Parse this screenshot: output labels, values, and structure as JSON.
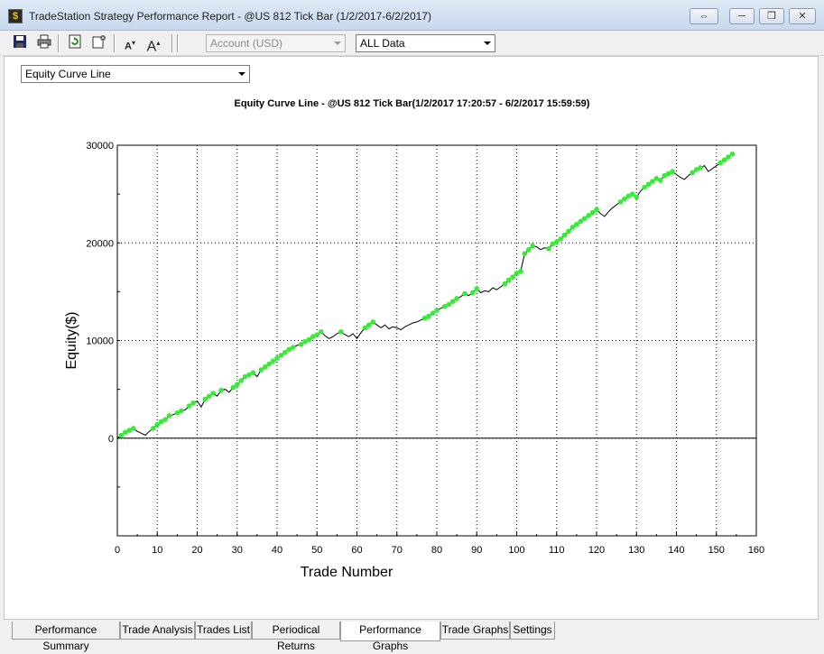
{
  "window": {
    "title": "TradeStation Strategy Performance Report - @US 812 Tick Bar (1/2/2017-6/2/2017)",
    "icon": "tradestation-app-icon",
    "buttons": {
      "restore_icon": "⇔",
      "minimize_icon": "─",
      "maximize_icon": "❐",
      "close_icon": "✕"
    }
  },
  "toolbar": {
    "save_icon": "save-icon",
    "print_icon": "print-icon",
    "refresh_icon": "refresh-icon",
    "settings_icon": "settings-icon",
    "font_smaller_label": "A",
    "font_larger_label": "A",
    "account_combo": "Account (USD)",
    "data_combo": "ALL Data"
  },
  "graph_selector": {
    "value": "Equity Curve Line"
  },
  "chart_title": "Equity Curve Line - @US 812 Tick Bar(1/2/2017 17:20:57 - 6/2/2017 15:59:59)",
  "tabs": [
    {
      "label": "Performance Summary",
      "active": false
    },
    {
      "label": "Trade Analysis",
      "active": false
    },
    {
      "label": "Trades List",
      "active": false
    },
    {
      "label": "Periodical Returns",
      "active": false
    },
    {
      "label": "Performance Graphs",
      "active": true
    },
    {
      "label": "Trade Graphs",
      "active": false
    },
    {
      "label": "Settings",
      "active": false
    }
  ],
  "chart_data": {
    "type": "line",
    "xlabel": "Trade Number",
    "ylabel": "Equity($)",
    "xlim": [
      0,
      160
    ],
    "ylim": [
      -10000,
      30000
    ],
    "x_ticks": [
      0,
      10,
      20,
      30,
      40,
      50,
      60,
      70,
      80,
      90,
      100,
      110,
      120,
      130,
      140,
      150,
      160
    ],
    "y_ticks": [
      0,
      10000,
      20000,
      30000
    ],
    "grid": true,
    "line_color": "#000000",
    "marker_color": "#33ee33",
    "x": [
      0,
      1,
      2,
      3,
      4,
      5,
      6,
      7,
      8,
      9,
      10,
      11,
      12,
      13,
      14,
      15,
      16,
      17,
      18,
      19,
      20,
      21,
      22,
      23,
      24,
      25,
      26,
      27,
      28,
      29,
      30,
      31,
      32,
      33,
      34,
      35,
      36,
      37,
      38,
      39,
      40,
      41,
      42,
      43,
      44,
      45,
      46,
      47,
      48,
      49,
      50,
      51,
      52,
      53,
      54,
      55,
      56,
      57,
      58,
      59,
      60,
      61,
      62,
      63,
      64,
      65,
      66,
      67,
      68,
      69,
      70,
      71,
      72,
      73,
      74,
      75,
      76,
      77,
      78,
      79,
      80,
      81,
      82,
      83,
      84,
      85,
      86,
      87,
      88,
      89,
      90,
      91,
      92,
      93,
      94,
      95,
      96,
      97,
      98,
      99,
      100,
      101,
      102,
      103,
      104,
      105,
      106,
      107,
      108,
      109,
      110,
      111,
      112,
      113,
      114,
      115,
      116,
      117,
      118,
      119,
      120,
      121,
      122,
      123,
      124,
      125,
      126,
      127,
      128,
      129,
      130,
      131,
      132,
      133,
      134,
      135,
      136,
      137,
      138,
      139,
      140,
      141,
      142,
      143,
      144,
      145,
      146,
      147,
      148,
      149,
      150,
      151,
      152,
      153,
      154
    ],
    "y": [
      0,
      300,
      600,
      800,
      1000,
      700,
      500,
      300,
      700,
      1000,
      1400,
      1700,
      1900,
      2300,
      2400,
      2600,
      2800,
      2900,
      3300,
      3600,
      3800,
      3200,
      4000,
      4300,
      4600,
      4300,
      4900,
      5000,
      4700,
      5200,
      5500,
      5900,
      6300,
      6500,
      6700,
      6300,
      7000,
      7300,
      7600,
      7900,
      8200,
      8500,
      8800,
      9100,
      9300,
      9500,
      9600,
      9900,
      10100,
      10400,
      10600,
      10900,
      10500,
      10200,
      10400,
      10700,
      10900,
      10600,
      10400,
      10700,
      10200,
      10800,
      11300,
      11600,
      11900,
      11600,
      11300,
      11600,
      11200,
      11400,
      11300,
      11100,
      11400,
      11600,
      11800,
      11900,
      12100,
      12300,
      12500,
      12800,
      13100,
      13300,
      13500,
      13700,
      14000,
      14300,
      14500,
      14800,
      14600,
      14900,
      15300,
      14900,
      15100,
      15000,
      15400,
      15200,
      15500,
      15800,
      16200,
      16500,
      16900,
      17100,
      18900,
      19300,
      19700,
      19600,
      19300,
      19500,
      19400,
      19900,
      20100,
      20400,
      20800,
      21200,
      21600,
      21900,
      22200,
      22500,
      22800,
      23100,
      23400,
      23000,
      22700,
      23200,
      23600,
      23900,
      24200,
      24500,
      24800,
      25000,
      24700,
      25300,
      25700,
      26000,
      26300,
      26600,
      26400,
      26900,
      27100,
      27300,
      27000,
      26700,
      26500,
      26900,
      27200,
      27500,
      27700,
      27900,
      27300,
      27600,
      27900,
      28200,
      28500,
      28800,
      29100
    ],
    "markers": [
      1,
      2,
      3,
      4,
      9,
      10,
      11,
      12,
      13,
      15,
      16,
      18,
      19,
      22,
      23,
      24,
      26,
      29,
      30,
      31,
      32,
      33,
      34,
      36,
      37,
      38,
      39,
      40,
      41,
      42,
      43,
      44,
      46,
      47,
      48,
      49,
      50,
      51,
      56,
      62,
      63,
      64,
      77,
      78,
      79,
      80,
      82,
      83,
      84,
      85,
      87,
      89,
      90,
      97,
      98,
      99,
      100,
      101,
      102,
      103,
      104,
      108,
      109,
      110,
      111,
      112,
      113,
      114,
      115,
      116,
      117,
      118,
      119,
      120,
      126,
      127,
      128,
      129,
      130,
      132,
      133,
      134,
      135,
      136,
      137,
      138,
      139,
      144,
      145,
      146,
      151,
      152,
      153,
      154
    ]
  }
}
